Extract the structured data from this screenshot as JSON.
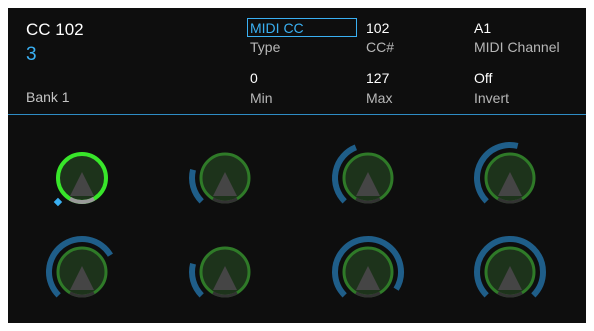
{
  "header": {
    "control_name": "CC 102",
    "control_index": "3",
    "bank": "Bank 1"
  },
  "params": {
    "type": {
      "value": "MIDI CC",
      "label": "Type"
    },
    "cc": {
      "value": "102",
      "label": "CC#"
    },
    "channel": {
      "value": "A1",
      "label": "MIDI Channel"
    },
    "min": {
      "value": "0",
      "label": "Min"
    },
    "max": {
      "value": "127",
      "label": "Max"
    },
    "invert": {
      "value": "Off",
      "label": "Invert"
    }
  },
  "colors": {
    "background": "#0e0e0e",
    "accent": "#3ab0f2",
    "selected_knob": "#38e62a",
    "knob_ring": "#2f7a28",
    "knob_fill": "#1d331b",
    "value_arc": "#1f5e89"
  },
  "knobs": [
    {
      "id": "knob-1",
      "selected": true,
      "level": 0.0
    },
    {
      "id": "knob-2",
      "selected": false,
      "level": 0.22
    },
    {
      "id": "knob-3",
      "selected": false,
      "level": 0.42
    },
    {
      "id": "knob-4",
      "selected": false,
      "level": 0.55
    },
    {
      "id": "knob-5",
      "selected": false,
      "level": 0.72
    },
    {
      "id": "knob-6",
      "selected": false,
      "level": 0.22
    },
    {
      "id": "knob-7",
      "selected": false,
      "level": 0.95
    },
    {
      "id": "knob-8",
      "selected": false,
      "level": 1.0
    }
  ]
}
